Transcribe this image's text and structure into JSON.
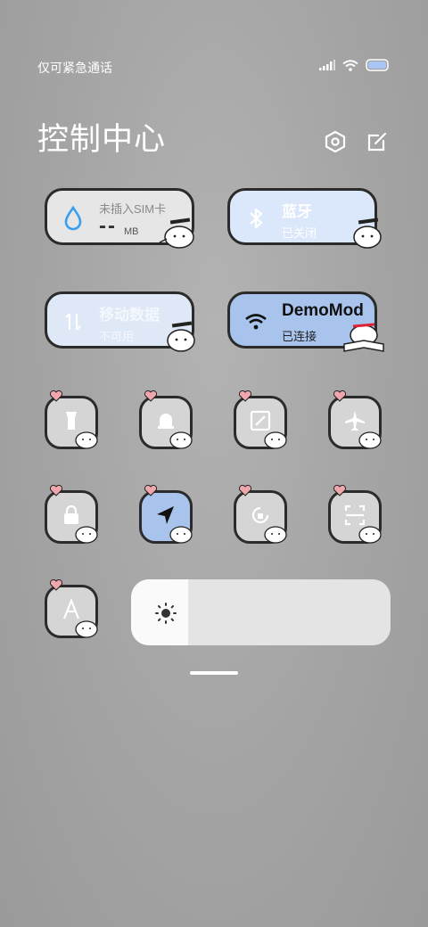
{
  "status_bar": {
    "carrier_text": "仅可紧急通话",
    "battery_color": "#a9c6f5"
  },
  "header": {
    "title": "控制中心",
    "settings_icon": "settings-hexagon-icon",
    "edit_icon": "edit-icon"
  },
  "tiles": {
    "data_usage": {
      "title": "未插入SIM卡",
      "value": "--",
      "unit": "MB",
      "icon": "water-drop-icon",
      "accent": "#3a9ef0"
    },
    "bluetooth": {
      "title": "蓝牙",
      "status": "已关闭",
      "icon": "bluetooth-icon"
    },
    "mobile_data": {
      "title": "移动数据",
      "status": "不可用",
      "icon": "mobile-data-arrows-icon"
    },
    "wifi": {
      "title": "DemoMod",
      "status": "已连接",
      "icon": "wifi-icon"
    }
  },
  "toggles": [
    {
      "name": "flashlight",
      "icon": "flashlight-icon",
      "active": false
    },
    {
      "name": "bell",
      "icon": "bell-icon",
      "active": false
    },
    {
      "name": "screenshot",
      "icon": "screenshot-icon",
      "active": false
    },
    {
      "name": "airplane-mode",
      "icon": "airplane-icon",
      "active": false
    },
    {
      "name": "lock-screen",
      "icon": "lock-icon",
      "active": false
    },
    {
      "name": "location",
      "icon": "location-arrow-icon",
      "active": true
    },
    {
      "name": "rotation-lock",
      "icon": "rotation-lock-icon",
      "active": false
    },
    {
      "name": "scanner",
      "icon": "scan-icon",
      "active": false
    },
    {
      "name": "auto-brightness",
      "icon": "auto-brightness-a-icon",
      "active": false
    }
  ],
  "brightness": {
    "icon": "sun-icon",
    "level": 0.22
  },
  "colors": {
    "tile_blue_light": "#dbe7fa",
    "tile_blue_active": "#a8c4ec",
    "tile_gray": "#cfcfcf",
    "heart": "#f0a6ad"
  }
}
